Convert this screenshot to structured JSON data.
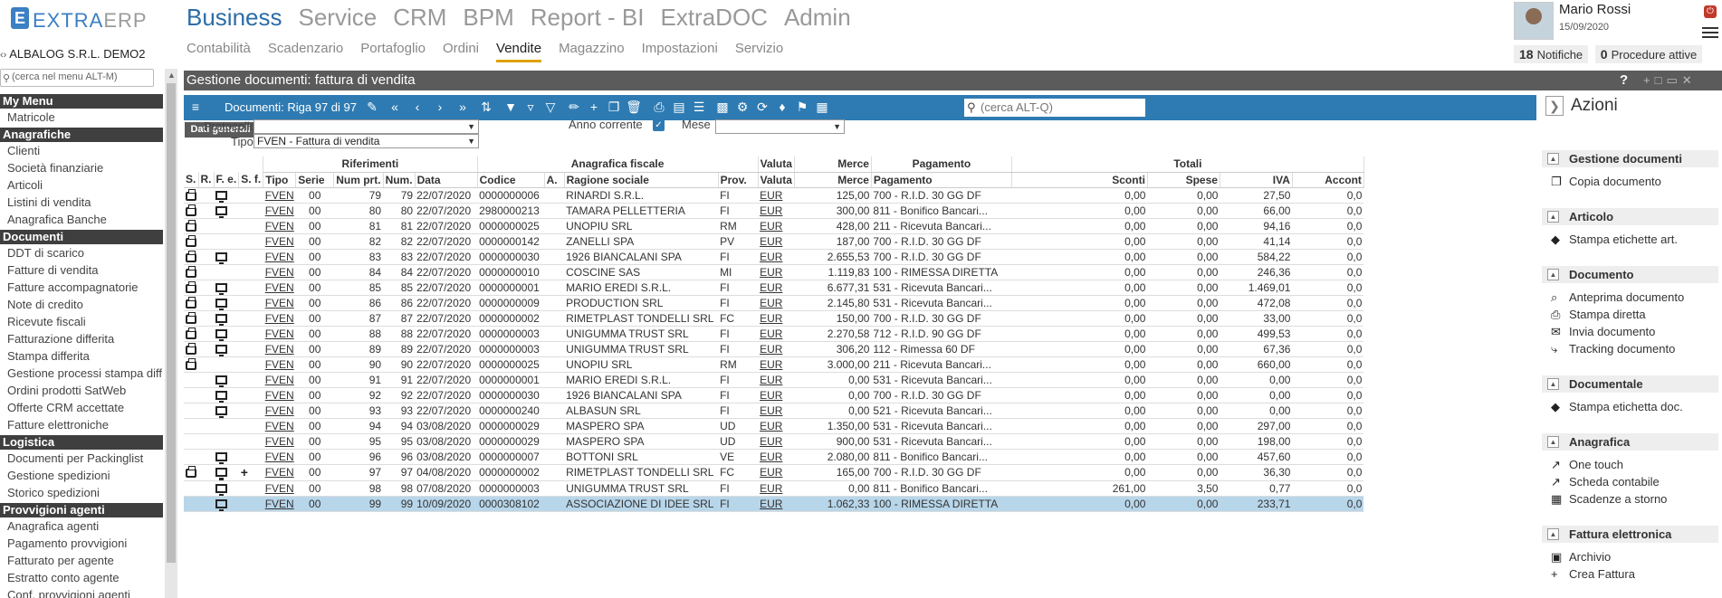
{
  "app": {
    "logo_letter": "E",
    "logo_text_a": "EXTRA",
    "logo_text_b": "ERP",
    "company": "ALBALOG S.R.L. DEMO2"
  },
  "main_nav": [
    "Business",
    "Service",
    "CRM",
    "BPM",
    "Report - BI",
    "ExtraDOC",
    "Admin"
  ],
  "sub_nav": [
    "Contabilità",
    "Scadenzario",
    "Portafoglio",
    "Ordini",
    "Vendite",
    "Magazzino",
    "Impostazioni",
    "Servizio"
  ],
  "user": {
    "name": "Mario Rossi",
    "date": "15/09/2020",
    "notifiche_count": "18",
    "notifiche_label": "Notifiche",
    "procedure_count": "0",
    "procedure_label": "Procedure attive"
  },
  "sidebar": {
    "search_placeholder": "(cerca nel menu ALT-M)",
    "sections": [
      {
        "title": "My Menu",
        "items": [
          "Matricole"
        ]
      },
      {
        "title": "Anagrafiche",
        "items": [
          "Clienti",
          "Società finanziarie",
          "Articoli",
          "Listini di vendita",
          "Anagrafica Banche"
        ]
      },
      {
        "title": "Documenti",
        "items": [
          "DDT di scarico",
          "Fatture di vendita",
          "Fatture  accompagnatorie",
          "Note di credito",
          "Ricevute fiscali",
          "Fatturazione differita",
          "Stampa differita",
          "Gestione processi stampa diff",
          "Ordini prodotti SatWeb",
          "Offerte CRM accettate",
          "Fatture elettroniche"
        ]
      },
      {
        "title": "Logistica",
        "items": [
          "Documenti per Packinglist",
          "Gestione spedizioni",
          "Storico spedizioni"
        ]
      },
      {
        "title": "Provvigioni agenti",
        "items": [
          "Anagrafica agenti",
          "Pagamento provvigioni",
          "Fatturato per agente",
          "Estratto conto agente",
          "Conf. provvigioni agenti"
        ]
      }
    ]
  },
  "window": {
    "title": "Gestione documenti: fattura di vendita",
    "help": "?",
    "toolbar_title": "Documenti: Riga 97 di 97",
    "search_placeholder": "(cerca ALT-Q)",
    "tab": "Dati generali"
  },
  "filters": {
    "protocollo_label": "Protocollo",
    "protocollo_value": "",
    "tipo_label": "Tipo",
    "tipo_value": "FVEN - Fattura di vendita",
    "anno_label": "Anno corrente",
    "anno_checked": true,
    "mese_label": "Mese",
    "mese_value": ""
  },
  "grid": {
    "group_headers": {
      "riferimenti": "Riferimenti",
      "anagrafica": "Anagrafica fiscale",
      "valuta": "Valuta",
      "merce": "Merce",
      "pagamento": "Pagamento",
      "totali": "Totali"
    },
    "columns": [
      "S.",
      "R.",
      "F. e.",
      "S. f.",
      "Tipo",
      "Serie",
      "Num prt.",
      "Num.",
      "Data",
      "Codice",
      "A.",
      "Ragione sociale",
      "Prov.",
      "Valuta",
      "Merce",
      "Pagamento",
      "Sconti",
      "Spese",
      "IVA",
      "Accont"
    ],
    "rows": [
      {
        "s": true,
        "fe": true,
        "sf": false,
        "tipo": "FVEN",
        "serie": "00",
        "numprt": "79",
        "num": "79",
        "data": "22/07/2020",
        "codice": "0000000006",
        "ragione": "RINARDI S.R.L.",
        "prov": "FI",
        "valuta": "EUR",
        "merce": "125,00",
        "pag": "700 - R.I.D. 30 GG DF",
        "sconti": "0,00",
        "spese": "0,00",
        "iva": "27,50",
        "acc": "0,0"
      },
      {
        "s": true,
        "fe": true,
        "sf": false,
        "tipo": "FVEN",
        "serie": "00",
        "numprt": "80",
        "num": "80",
        "data": "22/07/2020",
        "codice": "2980000213",
        "ragione": "TAMARA PELLETTERIA",
        "prov": "FI",
        "valuta": "EUR",
        "merce": "300,00",
        "pag": "811 - Bonifico Bancari...",
        "sconti": "0,00",
        "spese": "0,00",
        "iva": "66,00",
        "acc": "0,0"
      },
      {
        "s": true,
        "fe": false,
        "sf": false,
        "tipo": "FVEN",
        "serie": "00",
        "numprt": "81",
        "num": "81",
        "data": "22/07/2020",
        "codice": "0000000025",
        "ragione": "UNOPIU SRL",
        "prov": "RM",
        "valuta": "EUR",
        "merce": "428,00",
        "pag": "211 - Ricevuta Bancari...",
        "sconti": "0,00",
        "spese": "0,00",
        "iva": "94,16",
        "acc": "0,0"
      },
      {
        "s": true,
        "fe": false,
        "sf": false,
        "tipo": "FVEN",
        "serie": "00",
        "numprt": "82",
        "num": "82",
        "data": "22/07/2020",
        "codice": "0000000142",
        "ragione": "ZANELLI SPA",
        "prov": "PV",
        "valuta": "EUR",
        "merce": "187,00",
        "pag": "700 - R.I.D. 30 GG DF",
        "sconti": "0,00",
        "spese": "0,00",
        "iva": "41,14",
        "acc": "0,0"
      },
      {
        "s": true,
        "fe": true,
        "sf": false,
        "tipo": "FVEN",
        "serie": "00",
        "numprt": "83",
        "num": "83",
        "data": "22/07/2020",
        "codice": "0000000030",
        "ragione": "1926 BIANCALANI SPA",
        "prov": "FI",
        "valuta": "EUR",
        "merce": "2.655,53",
        "pag": "700 - R.I.D. 30 GG DF",
        "sconti": "0,00",
        "spese": "0,00",
        "iva": "584,22",
        "acc": "0,0"
      },
      {
        "s": true,
        "fe": false,
        "sf": false,
        "tipo": "FVEN",
        "serie": "00",
        "numprt": "84",
        "num": "84",
        "data": "22/07/2020",
        "codice": "0000000010",
        "ragione": "COSCINE  SAS",
        "prov": "MI",
        "valuta": "EUR",
        "merce": "1.119,83",
        "pag": "100 - RIMESSA DIRETTA",
        "sconti": "0,00",
        "spese": "0,00",
        "iva": "246,36",
        "acc": "0,0"
      },
      {
        "s": true,
        "fe": true,
        "sf": false,
        "tipo": "FVEN",
        "serie": "00",
        "numprt": "85",
        "num": "85",
        "data": "22/07/2020",
        "codice": "0000000001",
        "ragione": "MARIO EREDI S.R.L.",
        "prov": "FI",
        "valuta": "EUR",
        "merce": "6.677,31",
        "pag": "531 - Ricevuta Bancari...",
        "sconti": "0,00",
        "spese": "0,00",
        "iva": "1.469,01",
        "acc": "0,0"
      },
      {
        "s": true,
        "fe": true,
        "sf": false,
        "tipo": "FVEN",
        "serie": "00",
        "numprt": "86",
        "num": "86",
        "data": "22/07/2020",
        "codice": "0000000009",
        "ragione": "PRODUCTION SRL",
        "prov": "FI",
        "valuta": "EUR",
        "merce": "2.145,80",
        "pag": "531 - Ricevuta Bancari...",
        "sconti": "0,00",
        "spese": "0,00",
        "iva": "472,08",
        "acc": "0,0"
      },
      {
        "s": true,
        "fe": true,
        "sf": false,
        "tipo": "FVEN",
        "serie": "00",
        "numprt": "87",
        "num": "87",
        "data": "22/07/2020",
        "codice": "0000000002",
        "ragione": "RIMETPLAST TONDELLI SRL",
        "prov": "FC",
        "valuta": "EUR",
        "merce": "150,00",
        "pag": "700 - R.I.D. 30 GG DF",
        "sconti": "0,00",
        "spese": "0,00",
        "iva": "33,00",
        "acc": "0,0"
      },
      {
        "s": true,
        "fe": true,
        "sf": false,
        "tipo": "FVEN",
        "serie": "00",
        "numprt": "88",
        "num": "88",
        "data": "22/07/2020",
        "codice": "0000000003",
        "ragione": "UNIGUMMA TRUST SRL",
        "prov": "FI",
        "valuta": "EUR",
        "merce": "2.270,58",
        "pag": "712 - R.I.D. 90 GG DF",
        "sconti": "0,00",
        "spese": "0,00",
        "iva": "499,53",
        "acc": "0,0"
      },
      {
        "s": true,
        "fe": true,
        "sf": false,
        "tipo": "FVEN",
        "serie": "00",
        "numprt": "89",
        "num": "89",
        "data": "22/07/2020",
        "codice": "0000000003",
        "ragione": "UNIGUMMA TRUST SRL",
        "prov": "FI",
        "valuta": "EUR",
        "merce": "306,20",
        "pag": "112 - Rimessa 60 DF",
        "sconti": "0,00",
        "spese": "0,00",
        "iva": "67,36",
        "acc": "0,0"
      },
      {
        "s": true,
        "fe": false,
        "sf": false,
        "tipo": "FVEN",
        "serie": "00",
        "numprt": "90",
        "num": "90",
        "data": "22/07/2020",
        "codice": "0000000025",
        "ragione": "UNOPIU SRL",
        "prov": "RM",
        "valuta": "EUR",
        "merce": "3.000,00",
        "pag": "211 - Ricevuta Bancari...",
        "sconti": "0,00",
        "spese": "0,00",
        "iva": "660,00",
        "acc": "0,0"
      },
      {
        "s": false,
        "fe": true,
        "sf": false,
        "tipo": "FVEN",
        "serie": "00",
        "numprt": "91",
        "num": "91",
        "data": "22/07/2020",
        "codice": "0000000001",
        "ragione": "MARIO EREDI S.R.L.",
        "prov": "FI",
        "valuta": "EUR",
        "merce": "0,00",
        "pag": "531 - Ricevuta Bancari...",
        "sconti": "0,00",
        "spese": "0,00",
        "iva": "0,00",
        "acc": "0,0"
      },
      {
        "s": false,
        "fe": true,
        "sf": false,
        "tipo": "FVEN",
        "serie": "00",
        "numprt": "92",
        "num": "92",
        "data": "22/07/2020",
        "codice": "0000000030",
        "ragione": "1926 BIANCALANI SPA",
        "prov": "FI",
        "valuta": "EUR",
        "merce": "0,00",
        "pag": "700 - R.I.D. 30 GG DF",
        "sconti": "0,00",
        "spese": "0,00",
        "iva": "0,00",
        "acc": "0,0"
      },
      {
        "s": false,
        "fe": true,
        "sf": false,
        "tipo": "FVEN",
        "serie": "00",
        "numprt": "93",
        "num": "93",
        "data": "22/07/2020",
        "codice": "0000000240",
        "ragione": "ALBASUN SRL",
        "prov": "FI",
        "valuta": "EUR",
        "merce": "0,00",
        "pag": "521 - Ricevuta Bancari...",
        "sconti": "0,00",
        "spese": "0,00",
        "iva": "0,00",
        "acc": "0,0"
      },
      {
        "s": false,
        "fe": false,
        "sf": false,
        "tipo": "FVEN",
        "serie": "00",
        "numprt": "94",
        "num": "94",
        "data": "03/08/2020",
        "codice": "0000000029",
        "ragione": "MASPERO SPA",
        "prov": "UD",
        "valuta": "EUR",
        "merce": "1.350,00",
        "pag": "531 - Ricevuta Bancari...",
        "sconti": "0,00",
        "spese": "0,00",
        "iva": "297,00",
        "acc": "0,0"
      },
      {
        "s": false,
        "fe": false,
        "sf": false,
        "tipo": "FVEN",
        "serie": "00",
        "numprt": "95",
        "num": "95",
        "data": "03/08/2020",
        "codice": "0000000029",
        "ragione": "MASPERO SPA",
        "prov": "UD",
        "valuta": "EUR",
        "merce": "900,00",
        "pag": "531 - Ricevuta Bancari...",
        "sconti": "0,00",
        "spese": "0,00",
        "iva": "198,00",
        "acc": "0,0"
      },
      {
        "s": false,
        "fe": true,
        "sf": false,
        "tipo": "FVEN",
        "serie": "00",
        "numprt": "96",
        "num": "96",
        "data": "03/08/2020",
        "codice": "0000000007",
        "ragione": "BOTTONI SRL",
        "prov": "VE",
        "valuta": "EUR",
        "merce": "2.080,00",
        "pag": "811 - Bonifico Bancari...",
        "sconti": "0,00",
        "spese": "0,00",
        "iva": "457,60",
        "acc": "0,0"
      },
      {
        "s": true,
        "fe": true,
        "sf": true,
        "tipo": "FVEN",
        "serie": "00",
        "numprt": "97",
        "num": "97",
        "data": "04/08/2020",
        "codice": "0000000002",
        "ragione": "RIMETPLAST TONDELLI SRL",
        "prov": "FC",
        "valuta": "EUR",
        "merce": "165,00",
        "pag": "700 - R.I.D. 30 GG DF",
        "sconti": "0,00",
        "spese": "0,00",
        "iva": "36,30",
        "acc": "0,0"
      },
      {
        "s": false,
        "fe": true,
        "sf": false,
        "tipo": "FVEN",
        "serie": "00",
        "numprt": "98",
        "num": "98",
        "data": "07/08/2020",
        "codice": "0000000003",
        "ragione": "UNIGUMMA TRUST SRL",
        "prov": "FI",
        "valuta": "EUR",
        "merce": "0,00",
        "pag": "811 - Bonifico Bancari...",
        "sconti": "261,00",
        "spese": "3,50",
        "iva": "0,77",
        "acc": "0,0"
      },
      {
        "s": false,
        "fe": true,
        "sf": false,
        "tipo": "FVEN",
        "serie": "00",
        "numprt": "99",
        "num": "99",
        "data": "10/09/2020",
        "codice": "0000308102",
        "ragione": "ASSOCIAZIONE DI IDEE SRL",
        "prov": "FI",
        "valuta": "EUR",
        "merce": "1.062,33",
        "pag": "100 - RIMESSA DIRETTA",
        "sconti": "0,00",
        "spese": "0,00",
        "iva": "233,71",
        "acc": "0,0",
        "selected": true
      }
    ]
  },
  "azioni": {
    "title": "Azioni",
    "sections": [
      {
        "title": "Gestione documenti",
        "items": [
          {
            "icon": "copy-icon",
            "label": "Copia documento"
          }
        ]
      },
      {
        "title": "Articolo",
        "items": [
          {
            "icon": "tag-icon",
            "label": "Stampa etichette art."
          }
        ]
      },
      {
        "title": "Documento",
        "items": [
          {
            "icon": "magnifier-icon",
            "label": "Anteprima documento"
          },
          {
            "icon": "printer-icon",
            "label": "Stampa diretta"
          },
          {
            "icon": "envelope-icon",
            "label": "Invia documento"
          },
          {
            "icon": "tracking-icon",
            "label": "Tracking documento"
          }
        ]
      },
      {
        "title": "Documentale",
        "items": [
          {
            "icon": "tag-icon",
            "label": "Stampa etichetta doc."
          }
        ]
      },
      {
        "title": "Anagrafica",
        "items": [
          {
            "icon": "chart-icon",
            "label": "One touch"
          },
          {
            "icon": "chart-icon",
            "label": "Scheda contabile"
          },
          {
            "icon": "calendar-icon",
            "label": "Scadenze a storno"
          }
        ]
      },
      {
        "title": "Fattura elettronica",
        "items": [
          {
            "icon": "archive-icon",
            "label": "Archivio"
          },
          {
            "icon": "plus-icon",
            "label": "Crea Fattura"
          }
        ]
      }
    ]
  }
}
